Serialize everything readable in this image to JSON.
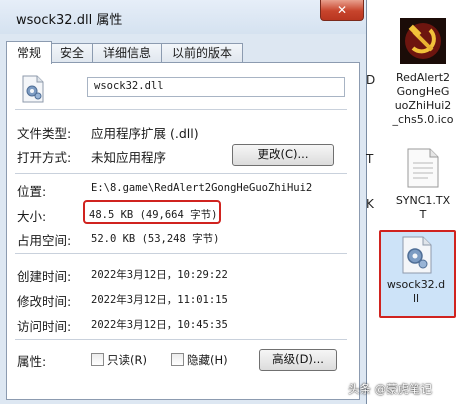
{
  "window": {
    "title": "wsock32.dll 属性",
    "close_glyph": "✕"
  },
  "tabs": [
    "常规",
    "安全",
    "详细信息",
    "以前的版本"
  ],
  "file": {
    "name": "wsock32.dll"
  },
  "fields": {
    "type_label": "文件类型:",
    "type_value": "应用程序扩展 (.dll)",
    "open_label": "打开方式:",
    "open_value": "未知应用程序",
    "change_button": "更改(C)...",
    "location_label": "位置:",
    "location_value": "E:\\8.game\\RedAlert2GongHeGuoZhiHui2",
    "size_label": "大小:",
    "size_value": "48.5 KB (49,664 字节)",
    "disk_label": "占用空间:",
    "disk_value": "52.0 KB (53,248 字节)",
    "created_label": "创建时间:",
    "created_value": "2022年3月12日，10:29:22",
    "modified_label": "修改时间:",
    "modified_value": "2022年3月12日，11:01:15",
    "accessed_label": "访问时间:",
    "accessed_value": "2022年3月12日，10:45:35",
    "attr_label": "属性:",
    "readonly_label": "只读(R)",
    "hidden_label": "隐藏(H)",
    "advanced_button": "高级(D)..."
  },
  "desktop": {
    "side_letters": [
      "D",
      "T",
      "K"
    ],
    "icons": [
      {
        "name": "RedAlert2GongHeGuoZhiHui2_chs5.0.ico",
        "lines": [
          "RedAlert2",
          "GongHeG",
          "uoZhiHui2",
          "_chs5.0.ico"
        ]
      },
      {
        "name": "SYNC1.TXT",
        "lines": [
          "SYNC1.TX",
          "T"
        ]
      },
      {
        "name": "wsock32.dll",
        "lines": [
          "wsock32.d",
          "ll"
        ]
      }
    ]
  },
  "watermark": "头条 @蒙虎笔记",
  "colors": {
    "highlight": "#d0231f",
    "dialog_bg": "#dde7f2",
    "close": "#c7442c"
  }
}
